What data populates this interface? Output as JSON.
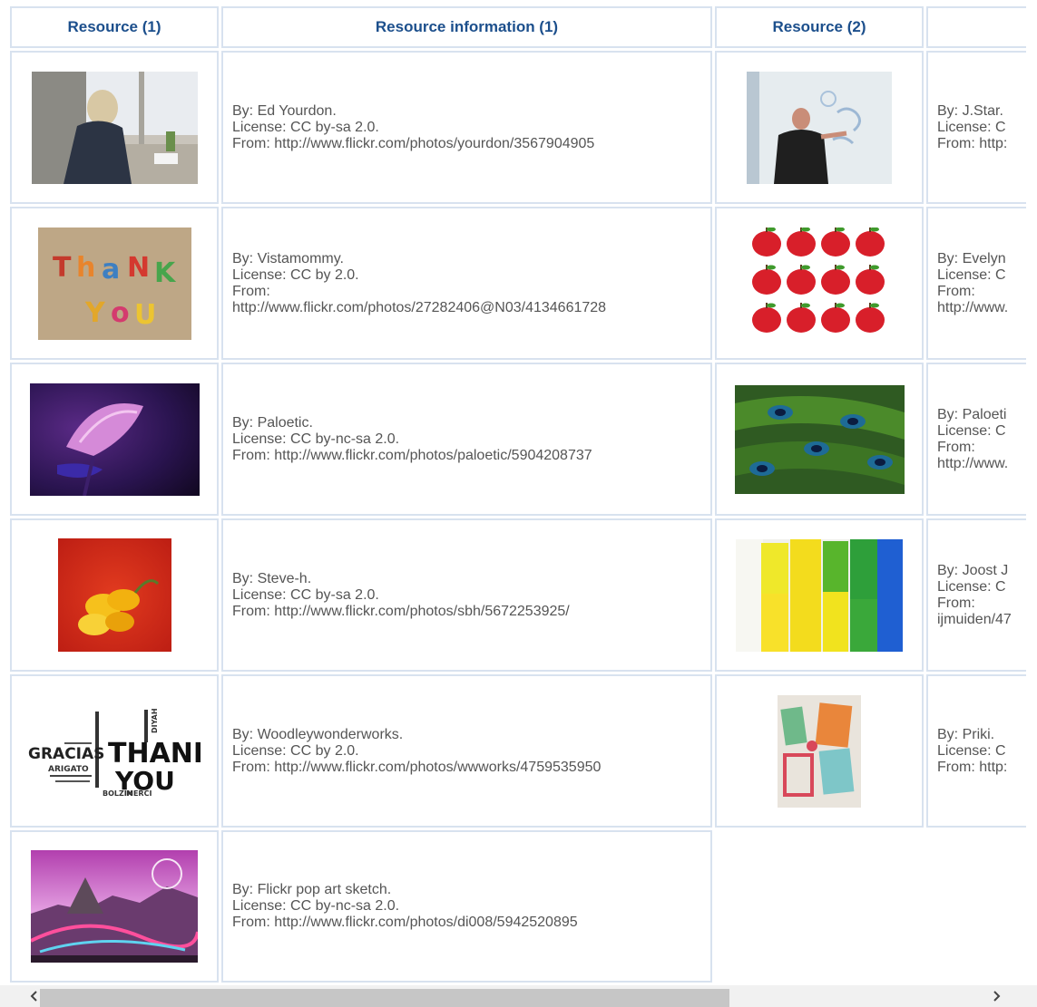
{
  "table": {
    "headers": [
      "Resource (1)",
      "Resource information (1)",
      "Resource (2)",
      ""
    ],
    "rows": [
      {
        "left": {
          "image": "woman-at-window-photo",
          "by": "By: Ed Yourdon.",
          "license": "License: CC by-sa 2.0.",
          "from": "From: http://www.flickr.com/photos/yourdon/3567904905"
        },
        "right": {
          "image": "thank-you-whiteboard-photo",
          "by": "By: J.Star.",
          "license": "License: C",
          "from": "From: http:"
        }
      },
      {
        "left": {
          "image": "thank-you-magnets-photo",
          "by": "By: Vistamommy.",
          "license": "License: CC by 2.0.",
          "from1": "From:",
          "from2": "http://www.flickr.com/photos/27282406@N03/4134661728"
        },
        "right": {
          "image": "red-apples-illustration",
          "by": "By: Evelyn",
          "license": "License: C",
          "from1": "From:",
          "from2": "http://www."
        }
      },
      {
        "left": {
          "image": "purple-flower-photo",
          "by": "By: Paloetic.",
          "license": "License: CC by-nc-sa 2.0.",
          "from": "From: http://www.flickr.com/photos/paloetic/5904208737"
        },
        "right": {
          "image": "peacock-feathers-photo",
          "by": "By: Paloeti",
          "license": "License: C",
          "from1": "From:",
          "from2": "http://www."
        }
      },
      {
        "left": {
          "image": "yellow-flower-photo",
          "by": "By: Steve-h.",
          "license": "License: CC by-sa 2.0.",
          "from": "From: http://www.flickr.com/photos/sbh/5672253925/"
        },
        "right": {
          "image": "colorful-cylinders-photo",
          "by": "By: Joost J",
          "license": "License: C",
          "from1": "From:",
          "from2": "ijmuiden/47"
        }
      },
      {
        "left": {
          "image": "thank-you-word-cloud",
          "by": "By: Woodleywonderworks.",
          "license": "License: CC by 2.0.",
          "from": "From: http://www.flickr.com/photos/wwworks/4759535950"
        },
        "right": {
          "image": "greeting-cards-photo",
          "by": "By: Priki.",
          "license": "License: C",
          "from": "From: http:"
        }
      },
      {
        "left": {
          "image": "pop-art-sketch-image",
          "by": "By: Flickr pop art sketch.",
          "license": "License: CC by-nc-sa 2.0.",
          "from": "From: http://www.flickr.com/photos/di008/5942520895"
        }
      }
    ]
  },
  "wordcloud": {
    "w1": "GRACIAS",
    "w2": "THANK",
    "w3": "YOU",
    "w4": "ARIGATO",
    "w5": "MERCI",
    "w6": "BOLZIN",
    "w7": "DIYAH"
  },
  "scrollbar": {
    "left_arrow": "‹",
    "right_arrow": "›"
  },
  "colors": {
    "header_text": "#1c4f8c",
    "border": "#d8e2ef",
    "body_text": "#555555",
    "scrollbar_track": "#f1f1f1",
    "scrollbar_thumb": "#c6c6c6"
  }
}
